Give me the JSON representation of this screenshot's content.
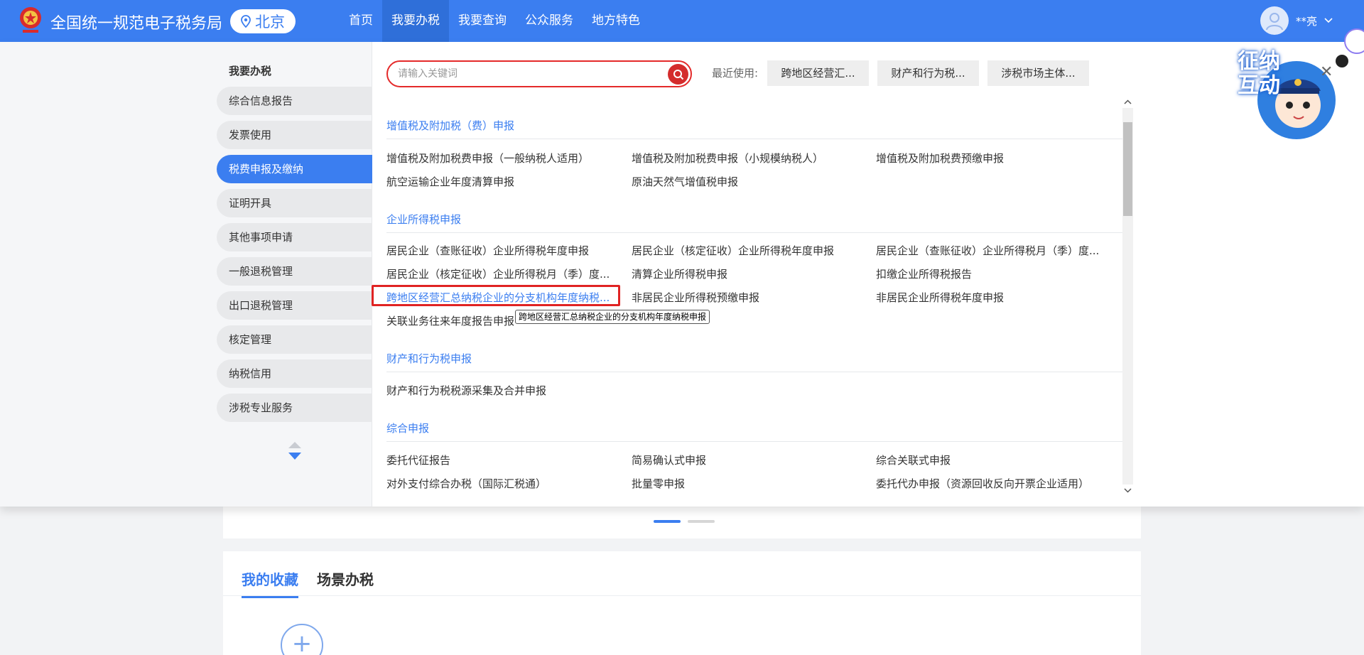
{
  "header": {
    "site_title": "全国统一规范电子税务局",
    "region": "北京",
    "nav": [
      "首页",
      "我要办税",
      "我要查询",
      "公众服务",
      "地方特色"
    ],
    "active_nav": "我要办税",
    "user_name": "**亮"
  },
  "sidebar": {
    "title": "我要办税",
    "items": [
      "综合信息报告",
      "发票使用",
      "税费申报及缴纳",
      "证明开具",
      "其他事项申请",
      "一般退税管理",
      "出口退税管理",
      "核定管理",
      "纳税信用",
      "涉税专业服务"
    ],
    "active": "税费申报及缴纳"
  },
  "search": {
    "placeholder": "请输入关键词"
  },
  "recent": {
    "label": "最近使用:",
    "items": [
      "跨地区经营汇...",
      "财产和行为税...",
      "涉税市场主体..."
    ]
  },
  "sections": [
    {
      "title": "增值税及附加税（费）申报",
      "links": [
        "增值税及附加税费申报（一般纳税人适用）",
        "增值税及附加税费申报（小规模纳税人）",
        "增值税及附加税费预缴申报",
        "航空运输企业年度清算申报",
        "原油天然气增值税申报"
      ]
    },
    {
      "title": "企业所得税申报",
      "links": [
        "居民企业（查账征收）企业所得税年度申报",
        "居民企业（核定征收）企业所得税年度申报",
        "居民企业（查账征收）企业所得税月（季）度...",
        "居民企业（核定征收）企业所得税月（季）度...",
        "清算企业所得税申报",
        "扣缴企业所得税报告",
        "跨地区经营汇总纳税企业的分支机构年度纳税...",
        "非居民企业所得税预缴申报",
        "非居民企业所得税年度申报",
        "关联业务往来年度报告申报"
      ]
    },
    {
      "title": "财产和行为税申报",
      "links": [
        "财产和行为税税源采集及合并申报"
      ]
    },
    {
      "title": "综合申报",
      "links": [
        "委托代征报告",
        "简易确认式申报",
        "综合关联式申报",
        "对外支付综合办税（国际汇税通）",
        "批量零申报",
        "委托代办申报（资源回收反向开票企业适用）"
      ]
    }
  ],
  "tooltip": "跨地区经营汇总纳税企业的分支机构年度纳税申报",
  "mascot_text": "征纳互动",
  "favorites_tabs": [
    "我的收藏",
    "场景办税"
  ],
  "colors": {
    "brand": "#3b7ef0",
    "highlight_red": "#e02323"
  }
}
